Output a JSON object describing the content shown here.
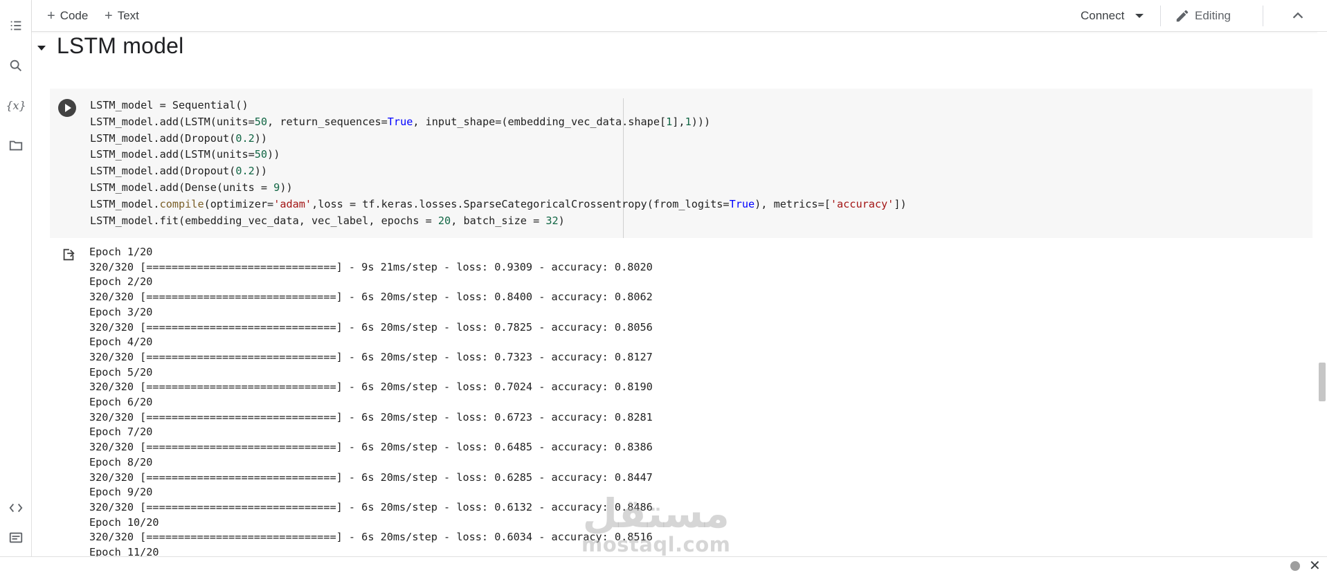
{
  "toolbar": {
    "add_code_label": "Code",
    "add_text_label": "Text",
    "connect_label": "Connect",
    "mode_label": "Editing"
  },
  "icons": {
    "rail": [
      "table-of-contents-icon",
      "search-icon",
      "variables-icon",
      "files-icon",
      "code-snippets-icon",
      "command-palette-icon"
    ],
    "variables_glyph": "{x}"
  },
  "section": {
    "title": "LSTM model"
  },
  "code_cell": {
    "lines": [
      [
        {
          "t": "LSTM_model = Sequential()"
        }
      ],
      [
        {
          "t": "LSTM_model.add(LSTM(units="
        },
        {
          "t": "50",
          "c": "n"
        },
        {
          "t": ", return_sequences="
        },
        {
          "t": "True",
          "c": "k"
        },
        {
          "t": ", input_shape=(embedding_vec_data.shape["
        },
        {
          "t": "1",
          "c": "n"
        },
        {
          "t": "],"
        },
        {
          "t": "1",
          "c": "n"
        },
        {
          "t": ")))"
        }
      ],
      [
        {
          "t": "LSTM_model.add(Dropout("
        },
        {
          "t": "0.2",
          "c": "n"
        },
        {
          "t": "))"
        }
      ],
      [
        {
          "t": "LSTM_model.add(LSTM(units="
        },
        {
          "t": "50",
          "c": "n"
        },
        {
          "t": "))"
        }
      ],
      [
        {
          "t": "LSTM_model.add(Dropout("
        },
        {
          "t": "0.2",
          "c": "n"
        },
        {
          "t": "))"
        }
      ],
      [
        {
          "t": "LSTM_model.add(Dense(units = "
        },
        {
          "t": "9",
          "c": "n"
        },
        {
          "t": "))"
        }
      ],
      [
        {
          "t": "LSTM_model."
        },
        {
          "t": "compile",
          "c": "f"
        },
        {
          "t": "(optimizer="
        },
        {
          "t": "'adam'",
          "c": "s"
        },
        {
          "t": ",loss = tf.keras.losses.SparseCategoricalCrossentropy(from_logits="
        },
        {
          "t": "True",
          "c": "k"
        },
        {
          "t": "), metrics=["
        },
        {
          "t": "'accuracy'",
          "c": "s"
        },
        {
          "t": "])"
        }
      ],
      [
        {
          "t": "LSTM_model.fit(embedding_vec_data, vec_label, epochs = "
        },
        {
          "t": "20",
          "c": "n"
        },
        {
          "t": ", batch_size = "
        },
        {
          "t": "32",
          "c": "n"
        },
        {
          "t": ")"
        }
      ]
    ]
  },
  "output": {
    "lines": [
      "Epoch 1/20",
      "320/320 [==============================] - 9s 21ms/step - loss: 0.9309 - accuracy: 0.8020",
      "Epoch 2/20",
      "320/320 [==============================] - 6s 20ms/step - loss: 0.8400 - accuracy: 0.8062",
      "Epoch 3/20",
      "320/320 [==============================] - 6s 20ms/step - loss: 0.7825 - accuracy: 0.8056",
      "Epoch 4/20",
      "320/320 [==============================] - 6s 20ms/step - loss: 0.7323 - accuracy: 0.8127",
      "Epoch 5/20",
      "320/320 [==============================] - 6s 20ms/step - loss: 0.7024 - accuracy: 0.8190",
      "Epoch 6/20",
      "320/320 [==============================] - 6s 20ms/step - loss: 0.6723 - accuracy: 0.8281",
      "Epoch 7/20",
      "320/320 [==============================] - 6s 20ms/step - loss: 0.6485 - accuracy: 0.8386",
      "Epoch 8/20",
      "320/320 [==============================] - 6s 20ms/step - loss: 0.6285 - accuracy: 0.8447",
      "Epoch 9/20",
      "320/320 [==============================] - 6s 20ms/step - loss: 0.6132 - accuracy: 0.8486",
      "Epoch 10/20",
      "320/320 [==============================] - 6s 20ms/step - loss: 0.6034 - accuracy: 0.8516",
      "Epoch 11/20"
    ]
  },
  "watermark": {
    "arabic": "مستقل",
    "latin": "mostaql.com"
  },
  "colors": {
    "number": "#116644",
    "string": "#a31515",
    "keyword": "#0000ff",
    "function": "#795e26",
    "cell_background": "#f7f7f7"
  }
}
